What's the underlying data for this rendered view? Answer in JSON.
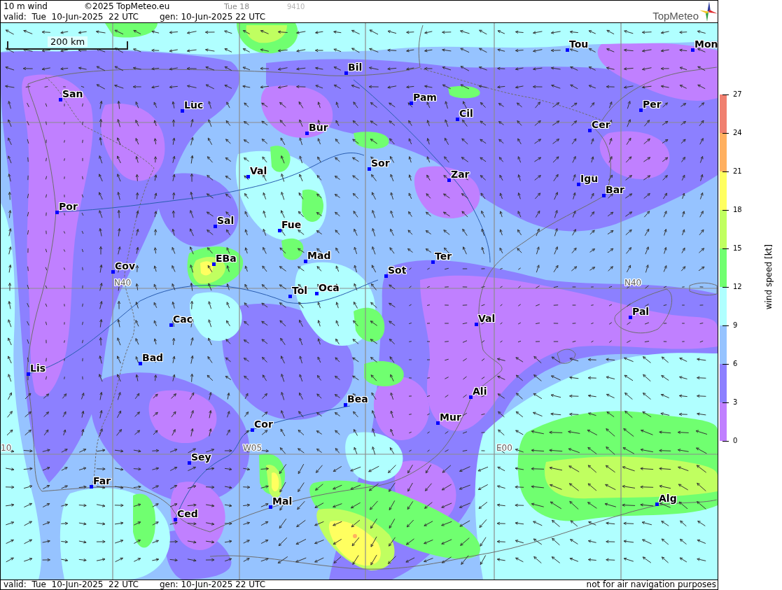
{
  "header": {
    "title": "10 m wind",
    "copyright": "©2025 TopMeteo.eu",
    "run_label": "Tue 18",
    "code": "9410",
    "valid": "valid:  Tue  10-Jun-2025  22 UTC",
    "generated": "gen: 10-Jun-2025 22 UTC",
    "logo_text": "TopMeteo"
  },
  "map": {
    "scale_label": "200 km",
    "grid_labels": [
      "N40",
      "N40",
      "10",
      "W05",
      "E00"
    ],
    "cities": [
      {
        "name": "Tou"
      },
      {
        "name": "Mon"
      },
      {
        "name": "Bil"
      },
      {
        "name": "San"
      },
      {
        "name": "Pam"
      },
      {
        "name": "Luc"
      },
      {
        "name": "Per"
      },
      {
        "name": "Cil"
      },
      {
        "name": "Bur"
      },
      {
        "name": "Cer"
      },
      {
        "name": "Sor"
      },
      {
        "name": "Val"
      },
      {
        "name": "Zar"
      },
      {
        "name": "Igu"
      },
      {
        "name": "Bar"
      },
      {
        "name": "Por"
      },
      {
        "name": "Sal"
      },
      {
        "name": "Fue"
      },
      {
        "name": "EBa"
      },
      {
        "name": "Mad"
      },
      {
        "name": "Ter"
      },
      {
        "name": "Cov"
      },
      {
        "name": "Sot"
      },
      {
        "name": "Tol"
      },
      {
        "name": "Oca"
      },
      {
        "name": "Pal"
      },
      {
        "name": "Cac"
      },
      {
        "name": "Val"
      },
      {
        "name": "Bad"
      },
      {
        "name": "Lis"
      },
      {
        "name": "Ali"
      },
      {
        "name": "Bea"
      },
      {
        "name": "Mur"
      },
      {
        "name": "Cor"
      },
      {
        "name": "Sey"
      },
      {
        "name": "Far"
      },
      {
        "name": "Mal"
      },
      {
        "name": "Alg"
      },
      {
        "name": "Ced"
      }
    ]
  },
  "legend": {
    "title": "wind speed [kt]",
    "ticks": [
      "27",
      "24",
      "21",
      "18",
      "15",
      "12",
      "9",
      "6",
      "3",
      "0"
    ],
    "bands": [
      {
        "color": "#f08070"
      },
      {
        "color": "#ffb060"
      },
      {
        "color": "#ffff60"
      },
      {
        "color": "#c0ff60"
      },
      {
        "color": "#70ff70"
      },
      {
        "color": "#b0ffff"
      },
      {
        "color": "#96c3ff"
      },
      {
        "color": "#8c80ff"
      },
      {
        "color": "#c080ff"
      }
    ]
  },
  "footer": {
    "valid": "valid:  Tue  10-Jun-2025  22 UTC",
    "generated": "gen: 10-Jun-2025 22 UTC",
    "disclaimer": "not for air navigation purposes"
  }
}
